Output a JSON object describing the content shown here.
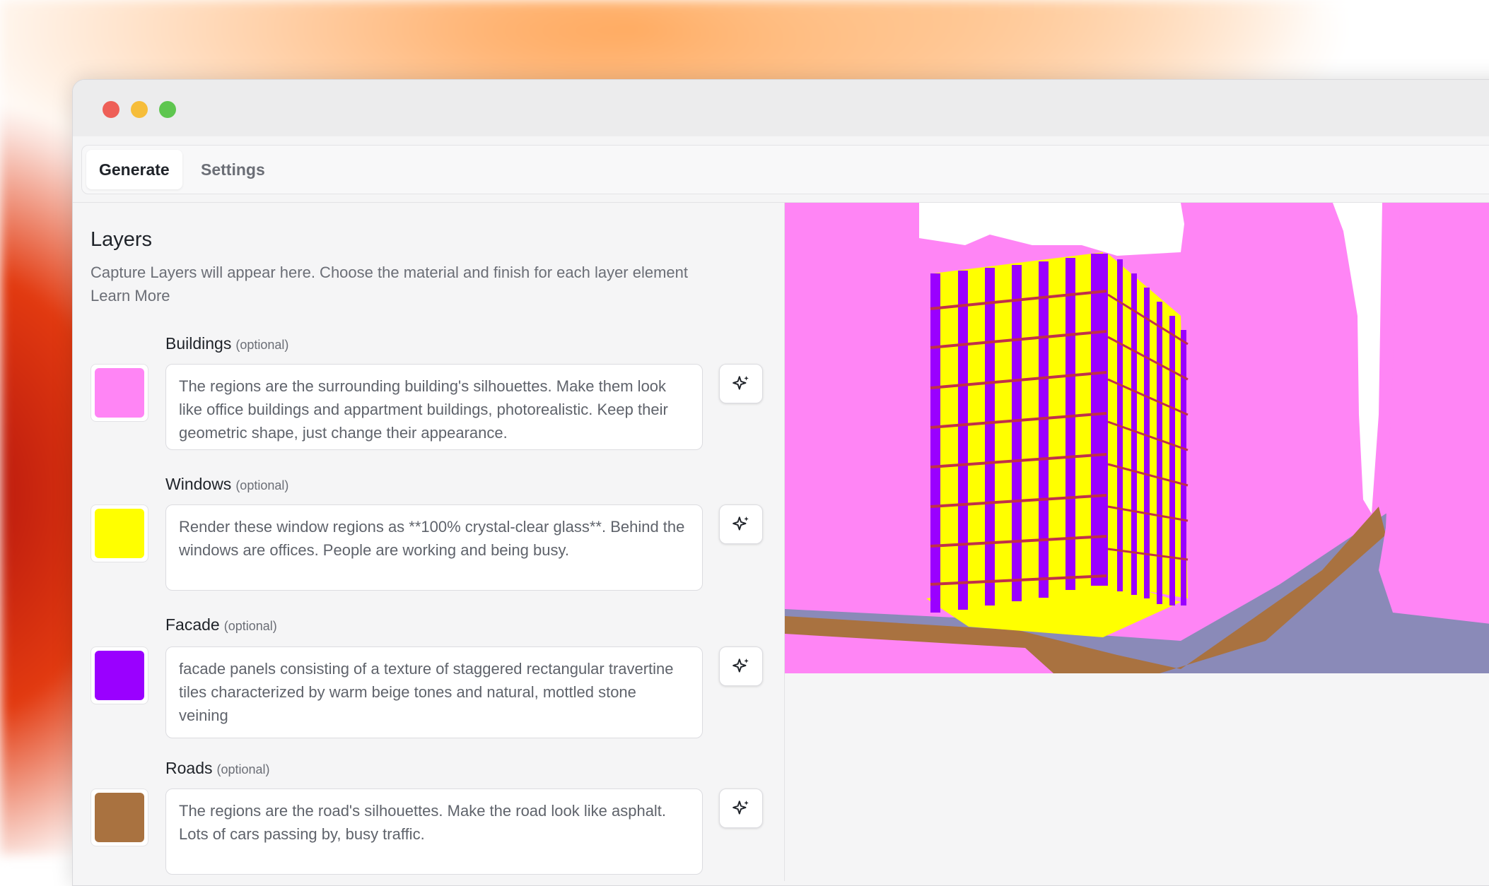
{
  "tabs": {
    "generate": "Generate",
    "settings": "Settings"
  },
  "layers_panel": {
    "title": "Layers",
    "description": "Capture Layers will appear here. Choose the material and finish for each layer element",
    "learn_more": "Learn More",
    "optional_tag": "(optional)",
    "items": [
      {
        "name": "Buildings",
        "color": "#ff85f5",
        "prompt": "The regions are the surrounding building's silhouettes. Make them look like office buildings and appartment buildings, photorealistic. Keep their geometric shape, just change their appearance."
      },
      {
        "name": "Windows",
        "color": "#ffff00",
        "prompt": "Render these window regions as **100% crystal-clear glass**. Behind the windows are offices. People are working and being busy."
      },
      {
        "name": "Facade",
        "color": "#9a00ff",
        "prompt": "facade panels consisting of a texture of staggered rectangular travertine tiles characterized by warm beige tones and natural, mottled stone veining"
      },
      {
        "name": "Roads",
        "color": "#a97240",
        "prompt": "The regions are the road's silhouettes. Make the road look like asphalt. Lots of cars passing by, busy traffic."
      }
    ]
  },
  "icons": {
    "magic": "sparkles-icon"
  }
}
